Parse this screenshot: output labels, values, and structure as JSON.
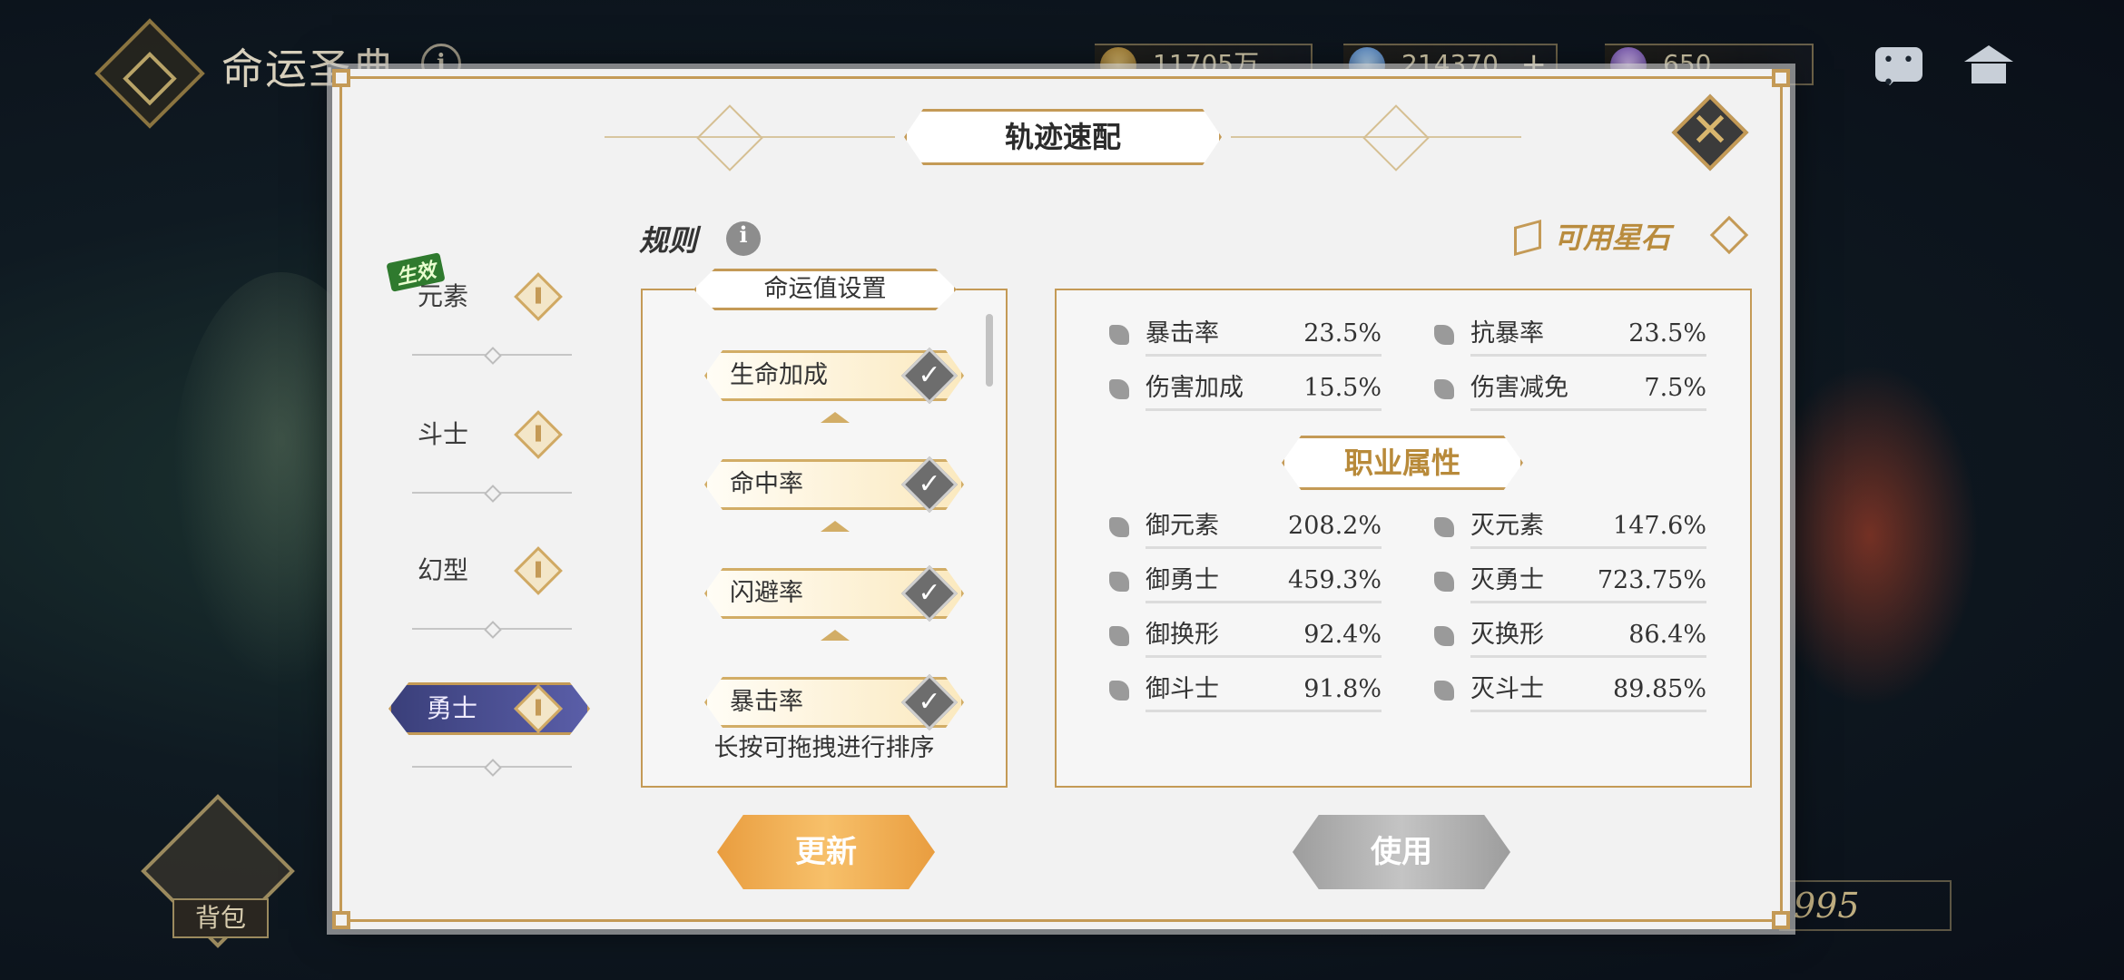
{
  "background": {
    "title": "命运圣典",
    "currencies": [
      {
        "value": "11705万"
      },
      {
        "value": "214370"
      },
      {
        "value": "650"
      }
    ],
    "bag_label": "背包",
    "right_number": "995"
  },
  "modal": {
    "title": "轨迹速配",
    "effect_badge": "生效",
    "tabs": [
      {
        "label": "元素"
      },
      {
        "label": "斗士"
      },
      {
        "label": "幻型"
      },
      {
        "label": "勇士"
      }
    ],
    "rule_label": "规则",
    "fate_setting": {
      "title": "命运值设置",
      "items": [
        {
          "label": "生命加成"
        },
        {
          "label": "命中率"
        },
        {
          "label": "闪避率"
        },
        {
          "label": "暴击率"
        }
      ],
      "hint": "长按可拖拽进行排序"
    },
    "stone_link": "可用星石",
    "stats": {
      "basic": [
        {
          "name": "暴击率",
          "value": "23.5%"
        },
        {
          "name": "抗暴率",
          "value": "23.5%"
        },
        {
          "name": "伤害加成",
          "value": "15.5%"
        },
        {
          "name": "伤害减免",
          "value": "7.5%"
        }
      ],
      "section_title": "职业属性",
      "class": [
        {
          "name": "御元素",
          "value": "208.2%"
        },
        {
          "name": "灭元素",
          "value": "147.6%"
        },
        {
          "name": "御勇士",
          "value": "459.3%"
        },
        {
          "name": "灭勇士",
          "value": "723.75%"
        },
        {
          "name": "御换形",
          "value": "92.4%"
        },
        {
          "name": "灭换形",
          "value": "86.4%"
        },
        {
          "name": "御斗士",
          "value": "91.8%"
        },
        {
          "name": "灭斗士",
          "value": "89.85%"
        }
      ]
    },
    "buttons": {
      "update": "更新",
      "use": "使用"
    }
  }
}
